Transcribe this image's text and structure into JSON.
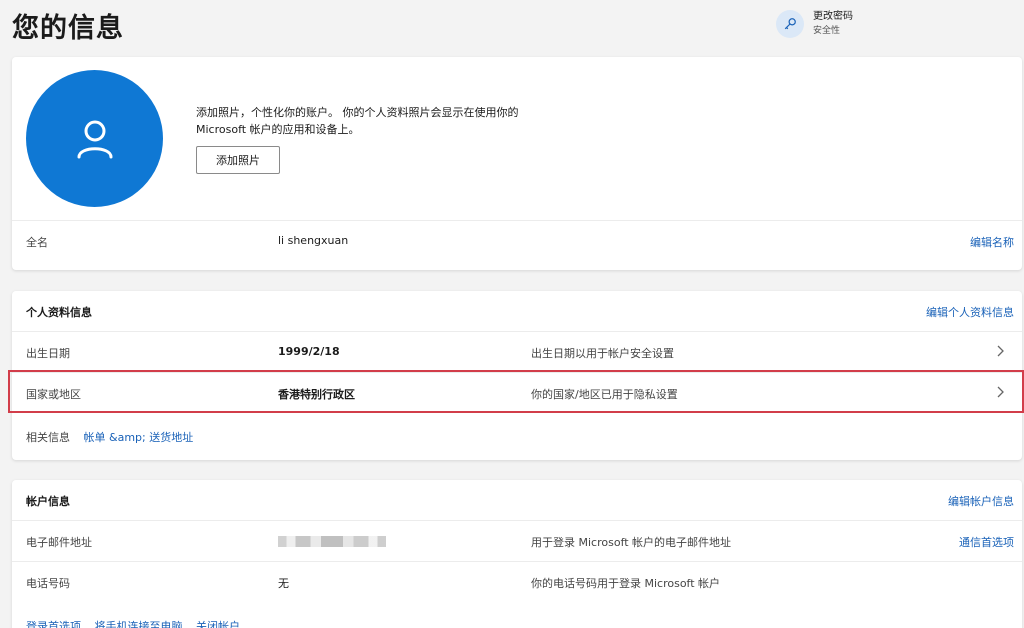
{
  "header": {
    "title": "您的信息",
    "password_link": {
      "title": "更改密码",
      "subtitle": "安全性",
      "icon": "key-icon"
    }
  },
  "photo_card": {
    "avatar_icon": "person-icon",
    "description": "添加照片，个性化你的账户。 你的个人资料照片会显示在使用你的 Microsoft 帐户的应用和设备上。",
    "add_photo_label": "添加照片",
    "full_name": {
      "label": "全名",
      "value": "li shengxuan",
      "action": "编辑名称"
    }
  },
  "profile_card": {
    "heading": "个人资料信息",
    "edit_label": "编辑个人资料信息",
    "rows": [
      {
        "label": "出生日期",
        "value": "1999/2/18",
        "note": "出生日期以用于帐户安全设置"
      },
      {
        "label": "国家或地区",
        "value": "香港特别行政区",
        "note": "你的国家/地区已用于隐私设置"
      }
    ],
    "related": {
      "label": "相关信息",
      "link": "帐单 &amp; 送货地址"
    }
  },
  "account_card": {
    "heading": "帐户信息",
    "edit_label": "编辑帐户信息",
    "rows": [
      {
        "label": "电子邮件地址",
        "value": "",
        "note": "用于登录 Microsoft 帐户的电子邮件地址",
        "action": "通信首选项"
      },
      {
        "label": "电话号码",
        "value": "无",
        "note": "你的电话号码用于登录 Microsoft 帐户"
      }
    ],
    "footer_links": [
      "登录首选项",
      "将手机连接至电脑",
      "关闭帐户"
    ]
  },
  "colors": {
    "accent": "#0f78d4",
    "link": "#1a62b8",
    "highlight": "#d23d4a"
  }
}
